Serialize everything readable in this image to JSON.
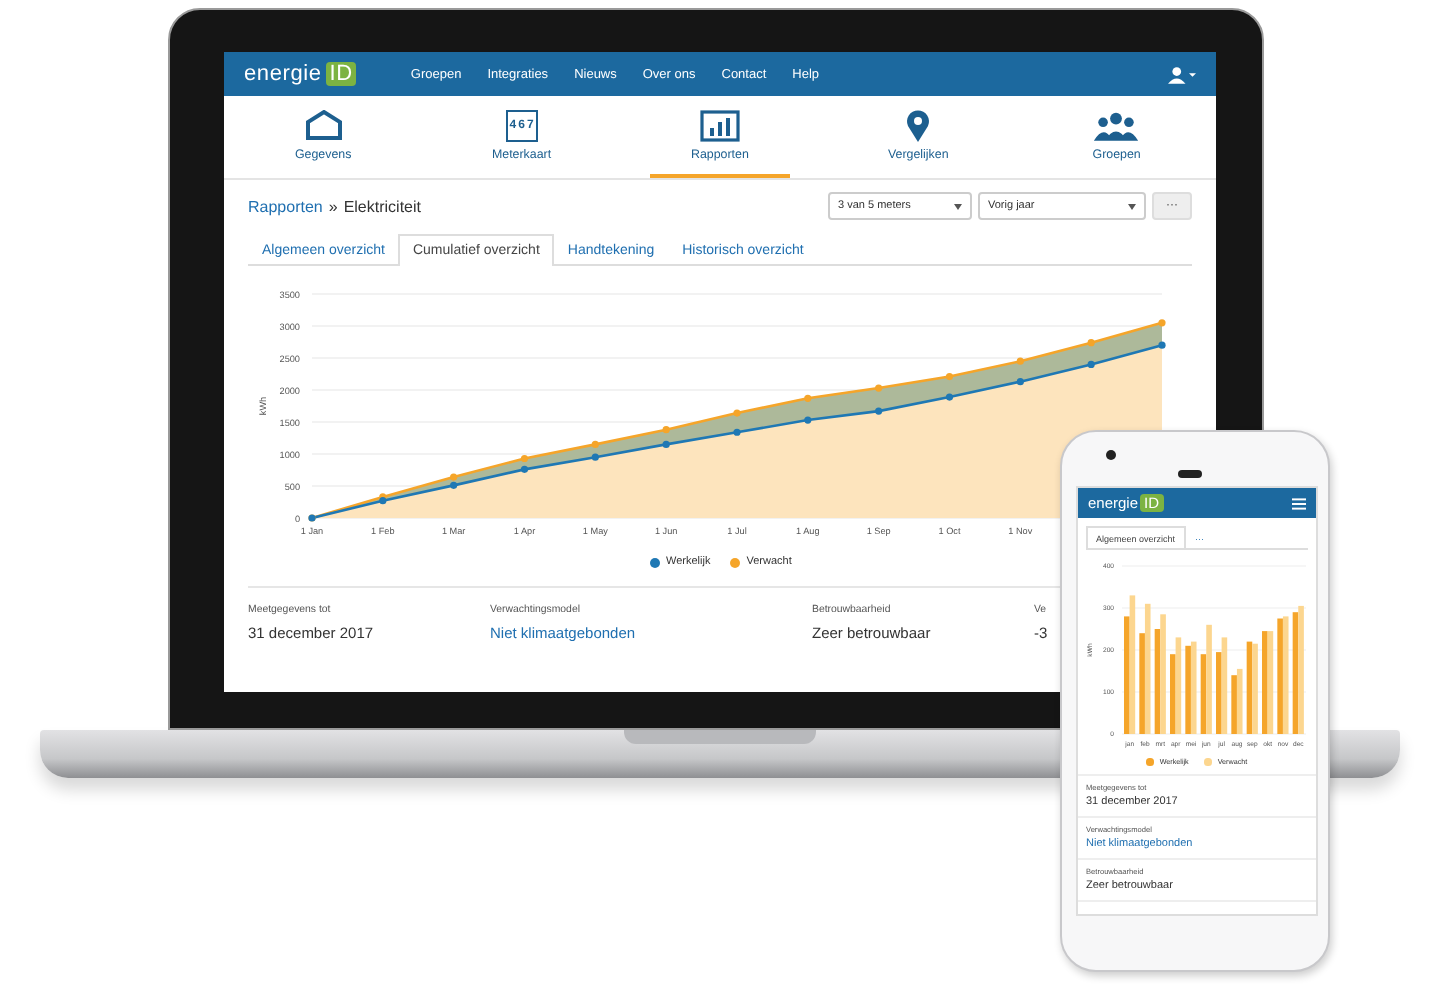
{
  "laptop": {
    "brand": {
      "text": "energie",
      "badge": "ID"
    },
    "nav_links": [
      "Groepen",
      "Integraties",
      "Nieuws",
      "Over ons",
      "Contact",
      "Help"
    ],
    "sections": [
      {
        "label": "Gegevens",
        "selected": false
      },
      {
        "label": "Meterkaart",
        "selected": false,
        "digits": [
          "4",
          "6",
          "7"
        ]
      },
      {
        "label": "Rapporten",
        "selected": true
      },
      {
        "label": "Vergelijken",
        "selected": false
      },
      {
        "label": "Groepen",
        "selected": false
      }
    ],
    "breadcrumb": {
      "link": "Rapporten",
      "separator": "»",
      "current": "Elektriciteit"
    },
    "filters": [
      {
        "value": "3 van 5 meters"
      },
      {
        "value": "Vorig jaar"
      }
    ],
    "more_button": "···",
    "tabs": [
      {
        "label": "Algemeen overzicht",
        "selected": false
      },
      {
        "label": "Cumulatief overzicht",
        "selected": true
      },
      {
        "label": "Handtekening",
        "selected": false
      },
      {
        "label": "Historisch overzicht",
        "selected": false
      }
    ],
    "chart_data": {
      "type": "area",
      "ylabel": "kWh",
      "grid": true,
      "legend": "bottom",
      "ylim": [
        0,
        3500
      ],
      "categories": [
        "1 Jan",
        "1 Feb",
        "1 Mar",
        "1 Apr",
        "1 May",
        "1 Jun",
        "1 Jul",
        "1 Aug",
        "1 Sep",
        "1 Oct",
        "1 Nov",
        null,
        null
      ],
      "yticks": [
        0,
        500,
        1000,
        1500,
        2000,
        2500,
        3000,
        3500
      ],
      "series": [
        {
          "name": "Werkelijk",
          "color": "#1f78b4",
          "values": [
            0,
            270,
            510,
            760,
            950,
            1150,
            1340,
            1530,
            1670,
            1890,
            2130,
            2400,
            2700
          ]
        },
        {
          "name": "Verwacht",
          "color": "#f5a52a",
          "values": [
            0,
            330,
            640,
            930,
            1150,
            1380,
            1640,
            1870,
            2030,
            2210,
            2450,
            2740,
            3050
          ]
        }
      ]
    },
    "facts": [
      {
        "label": "Meetgegevens tot",
        "value": "31 december 2017",
        "kind": "text"
      },
      {
        "label": "Verwachtingsmodel",
        "value": "Niet klimaatgebonden",
        "kind": "link"
      },
      {
        "label": "Betrouwbaarheid",
        "value": "Zeer betrouwbaar",
        "kind": "text"
      },
      {
        "label": "Ve",
        "value": "-3",
        "kind": "text"
      }
    ]
  },
  "phone": {
    "brand": {
      "text": "energie",
      "badge": "ID"
    },
    "tabs": [
      {
        "label": "Algemeen overzicht",
        "selected": true
      },
      {
        "label": "···",
        "selected": false
      }
    ],
    "chart_data": {
      "type": "bar",
      "ylabel": "kWh",
      "grid": true,
      "legend": "bottom",
      "categories": [
        "jan",
        "feb",
        "mrt",
        "apr",
        "mei",
        "jun",
        "jul",
        "aug",
        "sep",
        "okt",
        "nov",
        "dec"
      ],
      "ylim": [
        0,
        400
      ],
      "yticks": [
        0,
        100,
        200,
        300,
        400
      ],
      "series": [
        {
          "name": "Werkelijk",
          "color": "#f5a52a",
          "values": [
            280,
            240,
            250,
            190,
            210,
            190,
            195,
            140,
            220,
            245,
            275,
            290
          ]
        },
        {
          "name": "Verwacht",
          "color": "#fcd68f",
          "values": [
            330,
            310,
            285,
            230,
            220,
            260,
            230,
            155,
            215,
            245,
            280,
            305
          ]
        }
      ]
    },
    "facts": [
      {
        "label": "Meetgegevens tot",
        "value": "31 december 2017",
        "kind": "text"
      },
      {
        "label": "Verwachtingsmodel",
        "value": "Niet klimaatgebonden",
        "kind": "link"
      },
      {
        "label": "Betrouwbaarheid",
        "value": "Zeer betrouwbaar",
        "kind": "text"
      }
    ]
  }
}
